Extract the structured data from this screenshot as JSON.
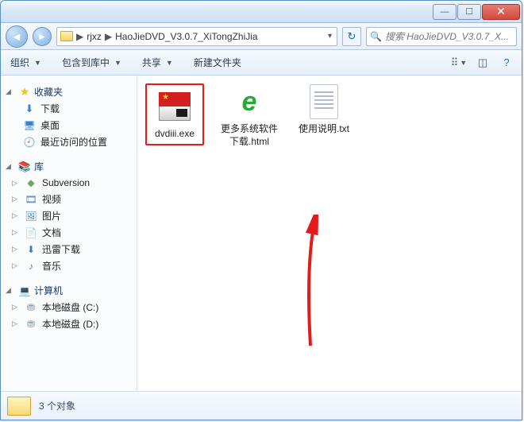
{
  "breadcrumbs": {
    "p1": "rjxz",
    "p2": "HaoJieDVD_V3.0.7_XiTongZhiJia",
    "sep": "▶"
  },
  "search": {
    "placeholder": "搜索 HaoJieDVD_V3.0.7_X..."
  },
  "toolbar": {
    "organize": "组织",
    "include": "包含到库中",
    "share": "共享",
    "newfolder": "新建文件夹"
  },
  "sidebar": {
    "favorites": {
      "label": "收藏夹",
      "items": [
        {
          "label": "下载"
        },
        {
          "label": "桌面"
        },
        {
          "label": "最近访问的位置"
        }
      ]
    },
    "libraries": {
      "label": "库",
      "items": [
        {
          "label": "Subversion"
        },
        {
          "label": "视频"
        },
        {
          "label": "图片"
        },
        {
          "label": "文档"
        },
        {
          "label": "迅雷下载"
        },
        {
          "label": "音乐"
        }
      ]
    },
    "computer": {
      "label": "计算机",
      "items": [
        {
          "label": "本地磁盘 (C:)"
        },
        {
          "label": "本地磁盘 (D:)"
        }
      ]
    }
  },
  "files": [
    {
      "name": "dvdiii.exe",
      "kind": "exe",
      "highlight": true
    },
    {
      "name": "更多系统软件下载.html",
      "kind": "html"
    },
    {
      "name": "使用说明.txt",
      "kind": "txt"
    }
  ],
  "status": {
    "text": "3 个对象"
  }
}
